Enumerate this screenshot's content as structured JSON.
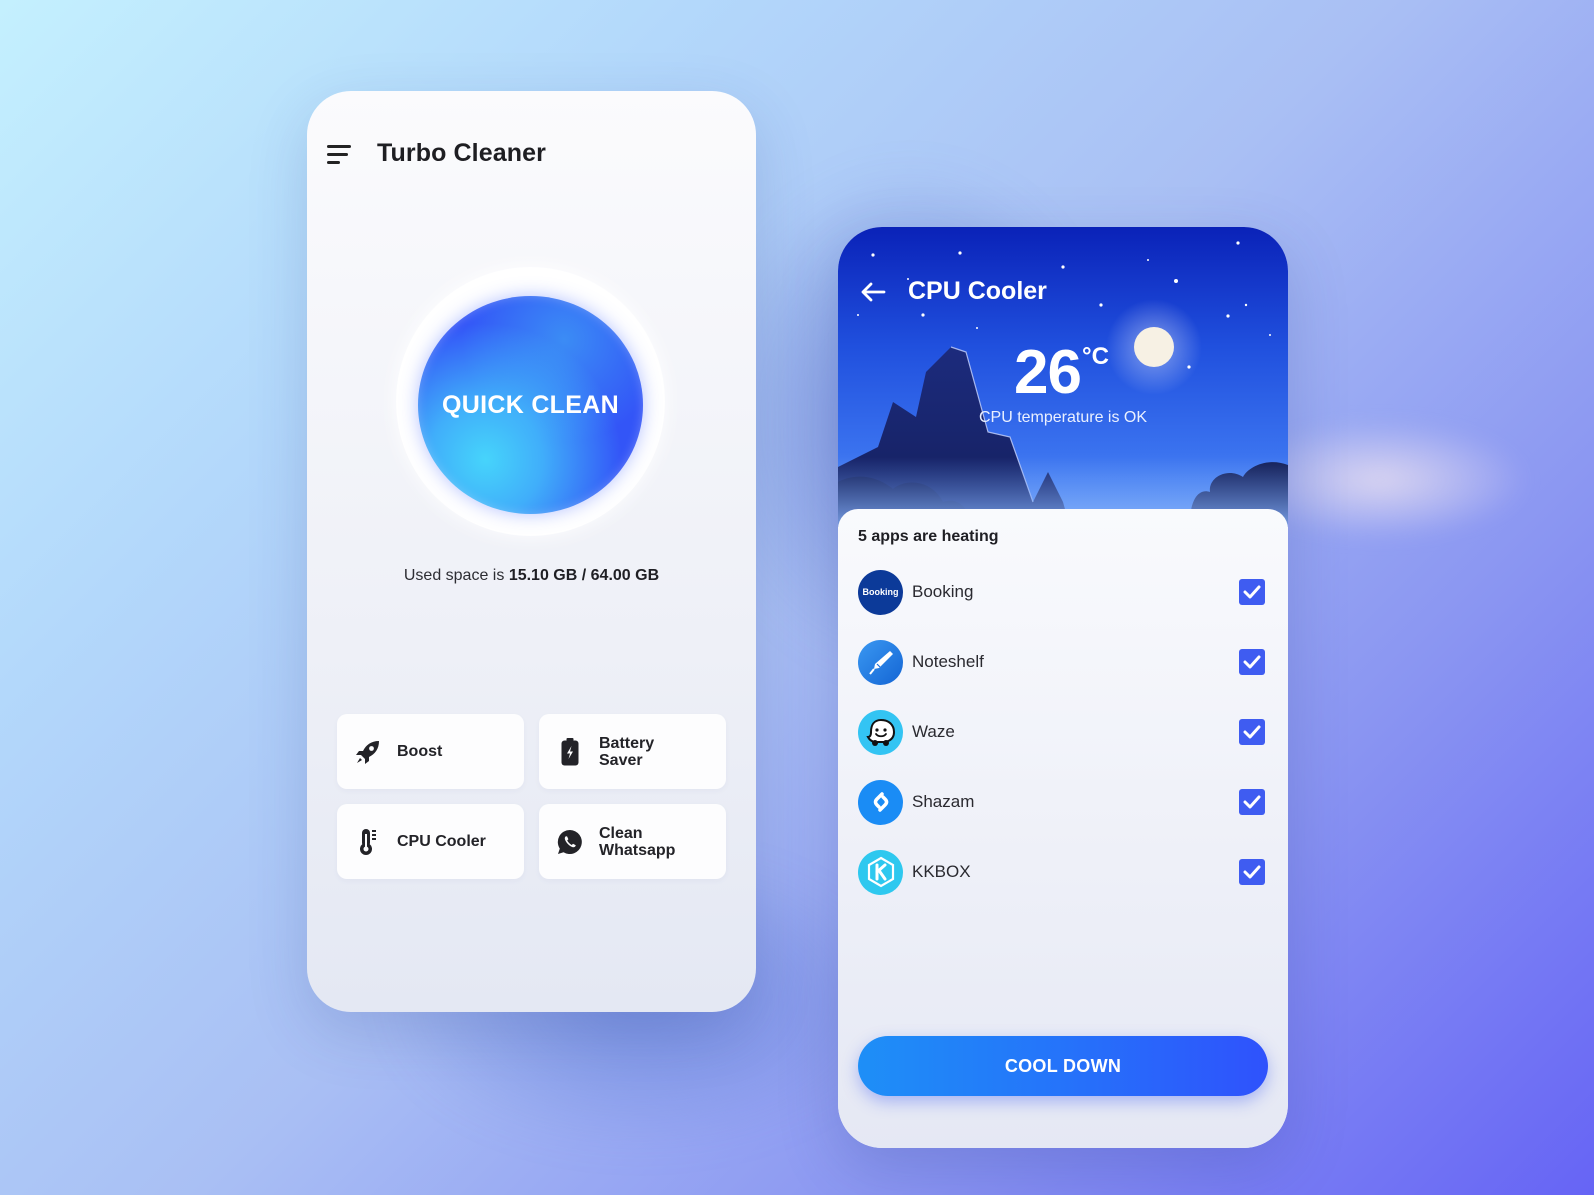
{
  "left_screen": {
    "title": "Turbo Cleaner",
    "menu_icon": "hamburger-menu-icon",
    "quick_clean": {
      "label": "QUICK CLEAN"
    },
    "storage": {
      "prefix": "Used space is",
      "used": "15.10 GB",
      "separator": "/",
      "total": "64.00 GB"
    },
    "tiles": [
      {
        "label": "Boost",
        "icon": "rocket-icon"
      },
      {
        "label": "Battery Saver",
        "line1": "Battery",
        "line2": "Saver",
        "icon": "battery-charging-icon"
      },
      {
        "label": "CPU Cooler",
        "icon": "thermometer-icon"
      },
      {
        "label": "Clean Whatsapp",
        "line1": "Clean",
        "line2": "Whatsapp",
        "icon": "whatsapp-icon"
      }
    ]
  },
  "right_screen": {
    "title": "CPU Cooler",
    "back_icon": "arrow-left-icon",
    "temperature": {
      "value": "26",
      "unit": "°C",
      "status": "CPU temperature is OK"
    },
    "heating_label": "5 apps are heating",
    "apps": [
      {
        "name": "Booking",
        "icon_text": "Booking",
        "color": "#0c3a99",
        "checked": true
      },
      {
        "name": "Noteshelf",
        "color": "#1f7be6",
        "checked": true
      },
      {
        "name": "Waze",
        "color": "#33c4f3",
        "checked": true
      },
      {
        "name": "Shazam",
        "color": "#1a8cf5",
        "checked": true
      },
      {
        "name": "KKBOX",
        "color": "#2ec8ef",
        "checked": true
      }
    ],
    "cool_down_label": "COOL DOWN",
    "accent_color": "#3f5cf1"
  }
}
